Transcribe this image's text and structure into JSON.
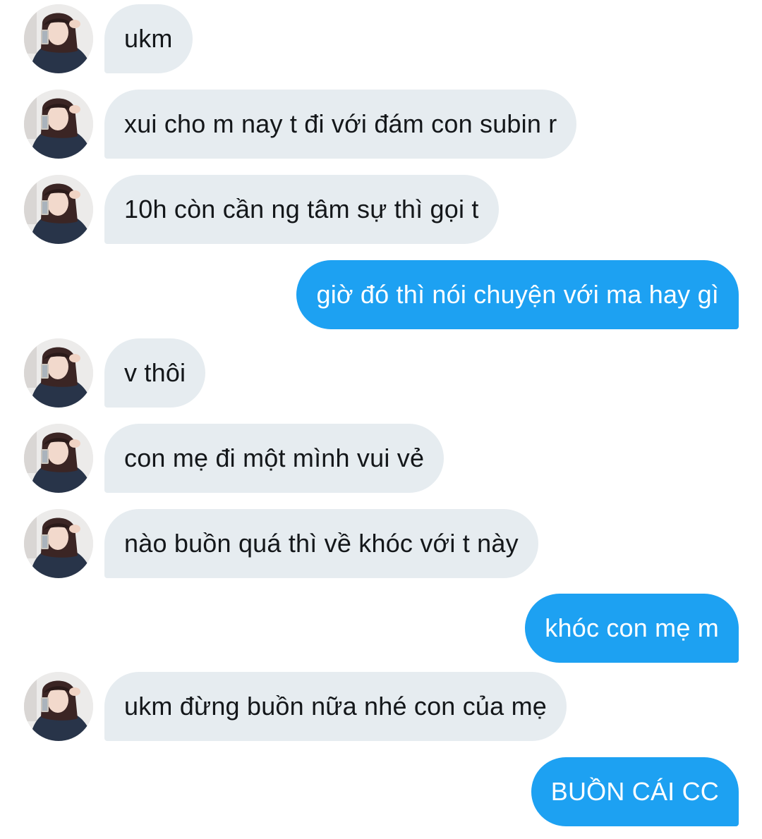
{
  "messages": [
    {
      "direction": "in",
      "text": "ukm"
    },
    {
      "direction": "in",
      "text": "xui cho m nay t đi với đám con subin r"
    },
    {
      "direction": "in",
      "text": "10h còn cần ng tâm sự thì gọi t"
    },
    {
      "direction": "out",
      "text": "giờ đó thì nói chuyện với ma hay gì"
    },
    {
      "direction": "in",
      "text": "v thôi"
    },
    {
      "direction": "in",
      "text": "con mẹ đi một mình vui vẻ"
    },
    {
      "direction": "in",
      "text": "nào buồn quá thì về khóc với t này"
    },
    {
      "direction": "out",
      "text": "khóc con mẹ m"
    },
    {
      "direction": "in",
      "text": "ukm đừng buồn nữa nhé con của mẹ"
    },
    {
      "direction": "out",
      "text": "BUỒN CÁI CC"
    }
  ],
  "colors": {
    "incoming_bubble": "#e6ecf0",
    "incoming_text": "#14171a",
    "outgoing_bubble": "#1da1f2",
    "outgoing_text": "#ffffff"
  }
}
